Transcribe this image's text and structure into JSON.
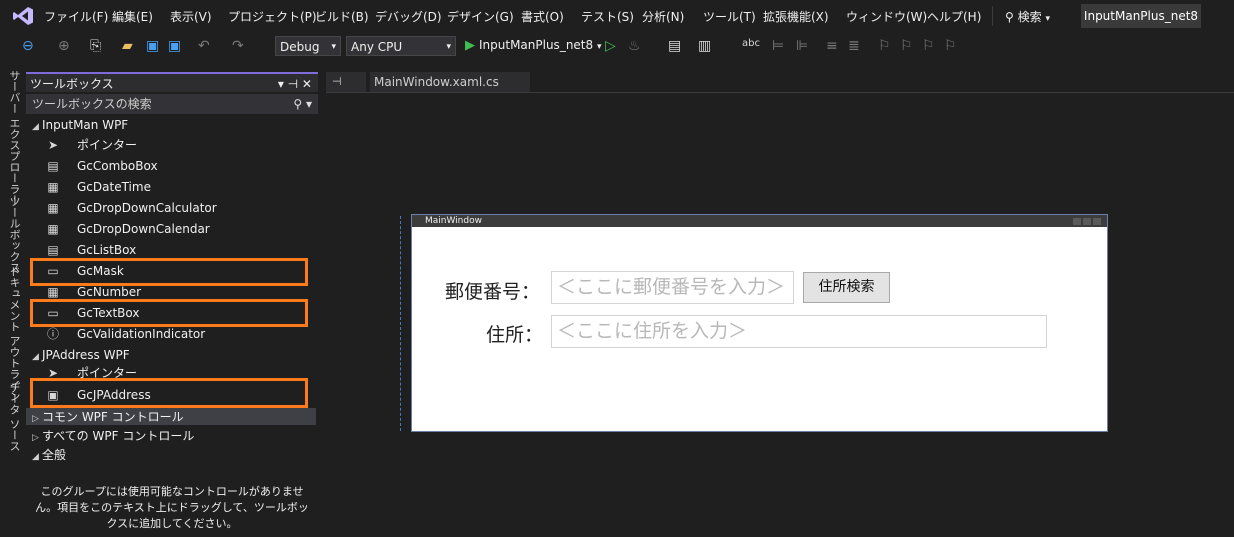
{
  "menubar": {
    "items": [
      "ファイル(F)",
      "編集(E)",
      "表示(V)",
      "プロジェクト(P)",
      "ビルド(B)",
      "デバッグ(D)",
      "デザイン(G)",
      "書式(O)",
      "テスト(S)",
      "分析(N)",
      "ツール(T)",
      "拡張機能(X)",
      "ウィンドウ(W)",
      "ヘルプ(H)"
    ],
    "search_label": "検索",
    "solution_name": "InputManPlus_net8"
  },
  "toolbar": {
    "config": "Debug",
    "platform": "Any CPU",
    "run_target": "InputManPlus_net8"
  },
  "side_tabs": [
    "サーバー エクスプローラー",
    "ツールボックス",
    "ドキュメント アウトライン",
    "データ ソース"
  ],
  "toolbox": {
    "title": "ツールボックス",
    "title_buttons": "▾ ⊣ ✕",
    "search_placeholder": "ツールボックスの検索",
    "groups": [
      {
        "label": "InputMan WPF",
        "expanded": true
      },
      {
        "label": "JPAddress WPF",
        "expanded": true
      },
      {
        "label": "コモン WPF コントロール",
        "expanded": false
      },
      {
        "label": "すべての WPF コントロール",
        "expanded": false
      },
      {
        "label": "全般",
        "expanded": true
      }
    ],
    "inputman_items": [
      "ポインター",
      "GcComboBox",
      "GcDateTime",
      "GcDropDownCalculator",
      "GcDropDownCalendar",
      "GcListBox",
      "GcMask",
      "GcNumber",
      "GcTextBox",
      "GcValidationIndicator"
    ],
    "jpaddress_items": [
      "ポインター",
      "GcJPAddress"
    ],
    "empty_message": "このグループには使用可能なコントロールがありません。項目をこのテキスト上にドラッグして、ツールボックスに追加してください。",
    "highlighted": [
      "GcMask",
      "GcTextBox",
      "GcJPAddress"
    ],
    "highlight_color": "#ff7a1a"
  },
  "designer": {
    "tab_pin": "⊣",
    "tab_file": "MainWindow.xaml.cs",
    "window_title": "MainWindow",
    "postal_label": "郵便番号：",
    "postal_placeholder": "＜ここに郵便番号を入力＞",
    "search_button": "住所検索",
    "address_label": "住所：",
    "address_placeholder": "＜ここに住所を入力＞"
  },
  "colors": {
    "accent": "#7f6cd8",
    "run": "#3fbe4f",
    "highlight": "#ff7a1a"
  }
}
